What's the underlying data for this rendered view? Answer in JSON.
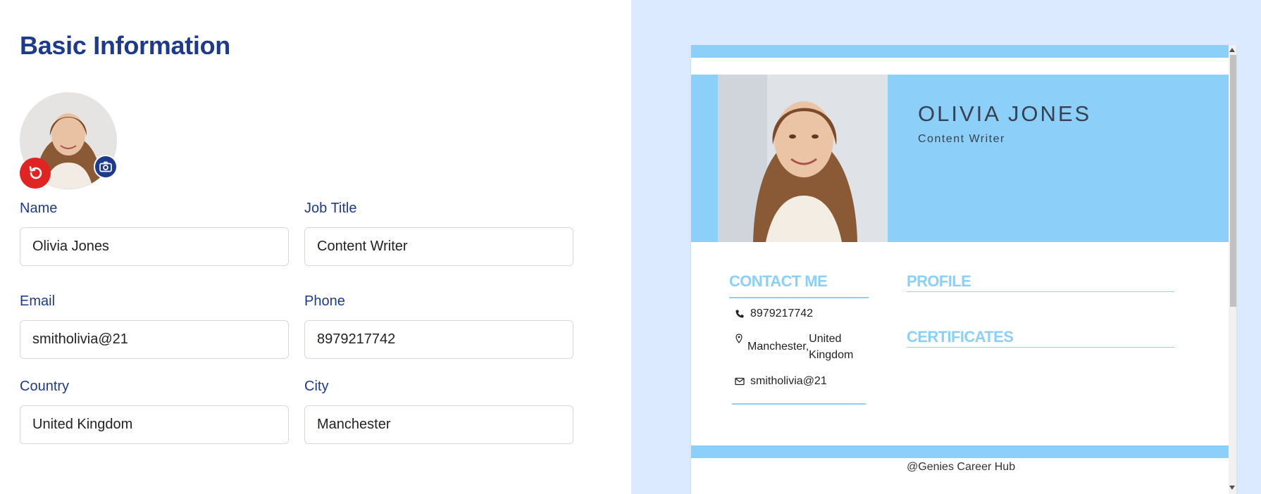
{
  "form": {
    "title": "Basic Information",
    "fields": {
      "name": {
        "label": "Name",
        "value": "Olivia Jones"
      },
      "job_title": {
        "label": "Job Title",
        "value": "Content Writer"
      },
      "email": {
        "label": "Email",
        "value": "smitholivia@21"
      },
      "phone": {
        "label": "Phone",
        "value": "8979217742"
      },
      "country": {
        "label": "Country",
        "value": "United Kingdom"
      },
      "city": {
        "label": "City",
        "value": "Manchester"
      }
    },
    "avatar_actions": {
      "reset_icon": "undo-icon",
      "upload_icon": "camera-icon"
    }
  },
  "preview": {
    "name": "OLIVIA JONES",
    "job_title": "Content Writer",
    "sections": {
      "contact": "CONTACT ME",
      "profile": "PROFILE",
      "certificates": "CERTIFICATES"
    },
    "contact": {
      "phone": "8979217742",
      "city": "Manchester,",
      "country": "United Kingdom",
      "email": "smitholivia@21"
    },
    "footer": "@Genies Career Hub"
  },
  "colors": {
    "primary": "#1e3a8a",
    "reset": "#e02424",
    "resume_accent": "#8ccff8",
    "preview_bg": "#dbeafe"
  }
}
